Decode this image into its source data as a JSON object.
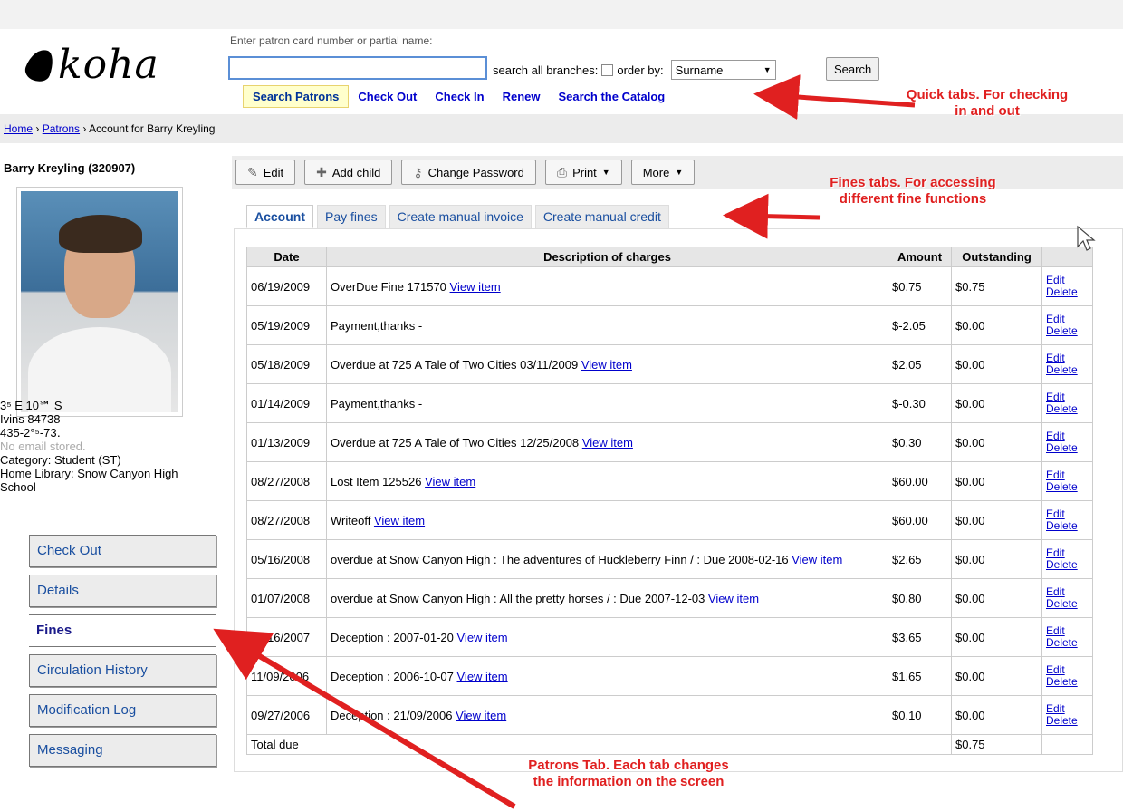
{
  "header": {
    "logo_text": "koha",
    "search_label": "Enter patron card number or partial name:",
    "search_value": "",
    "search_all_label": "search all branches:",
    "order_by_label": "order by:",
    "order_by_value": "Surname",
    "search_button": "Search",
    "quicktabs": [
      "Search Patrons",
      "Check Out",
      "Check In",
      "Renew",
      "Search the Catalog"
    ]
  },
  "breadcrumb": {
    "home": "Home",
    "patrons": "Patrons",
    "current": "Account for Barry Kreyling"
  },
  "patron": {
    "name": "Barry Kreyling (320907)",
    "address1": "3⁵ E 10℠ S",
    "city": "Ivins 84738",
    "phone": "435-2°⁵-73․",
    "email": "No email stored.",
    "category": "Category: Student (ST)",
    "library": "Home Library: Snow Canyon High School"
  },
  "patron_tabs": [
    "Check Out",
    "Details",
    "Fines",
    "Circulation History",
    "Modification Log",
    "Messaging"
  ],
  "toolbar": {
    "edit": "Edit",
    "add_child": "Add child",
    "change_password": "Change Password",
    "print": "Print",
    "more": "More"
  },
  "fine_tabs": [
    "Account",
    "Pay fines",
    "Create manual invoice",
    "Create manual credit"
  ],
  "table": {
    "headers": [
      "Date",
      "Description of charges",
      "Amount",
      "Outstanding"
    ],
    "rows": [
      {
        "date": "06/19/2009",
        "desc": "OverDue Fine 171570",
        "amount": "$0.75",
        "outstanding": "$0.75"
      },
      {
        "date": "05/19/2009",
        "desc": "Payment,thanks -",
        "amount": "$-2.05",
        "outstanding": "$0.00"
      },
      {
        "date": "05/18/2009",
        "desc": "Overdue at 725 A Tale of Two Cities 03/11/2009",
        "amount": "$2.05",
        "outstanding": "$0.00"
      },
      {
        "date": "01/14/2009",
        "desc": "Payment,thanks -",
        "amount": "$-0.30",
        "outstanding": "$0.00"
      },
      {
        "date": "01/13/2009",
        "desc": "Overdue at 725 A Tale of Two Cities 12/25/2008",
        "amount": "$0.30",
        "outstanding": "$0.00"
      },
      {
        "date": "08/27/2008",
        "desc": "Lost Item 125526",
        "amount": "$60.00",
        "outstanding": "$0.00"
      },
      {
        "date": "08/27/2008",
        "desc": "Writeoff",
        "amount": "$60.00",
        "outstanding": "$0.00"
      },
      {
        "date": "05/16/2008",
        "desc": "overdue at Snow Canyon High : The adventures of Huckleberry Finn / : Due 2008-02-16",
        "amount": "$2.65",
        "outstanding": "$0.00"
      },
      {
        "date": "01/07/2008",
        "desc": "overdue at Snow Canyon High : All the pretty horses / : Due 2007-12-03",
        "amount": "$0.80",
        "outstanding": "$0.00"
      },
      {
        "date": "05/16/2007",
        "desc": "Deception : 2007-01-20",
        "amount": "$3.65",
        "outstanding": "$0.00"
      },
      {
        "date": "11/09/2006",
        "desc": "Deception : 2006-10-07",
        "amount": "$1.65",
        "outstanding": "$0.00"
      },
      {
        "date": "09/27/2006",
        "desc": "Deception : 21/09/2006",
        "amount": "$0.10",
        "outstanding": "$0.00"
      }
    ],
    "view_item_label": "View item",
    "edit_label": "Edit",
    "delete_label": "Delete",
    "total_label": "Total due",
    "total_value": "$0.75"
  },
  "annotations": {
    "quick_tabs": "Quick tabs. For checking in and out",
    "fines_tabs": "Fines tabs. For accessing different fine functions",
    "patrons_tab": "Patrons Tab. Each tab changes the information on the screen"
  },
  "colors": {
    "link": "#0000cc",
    "annotation": "#e02020"
  }
}
